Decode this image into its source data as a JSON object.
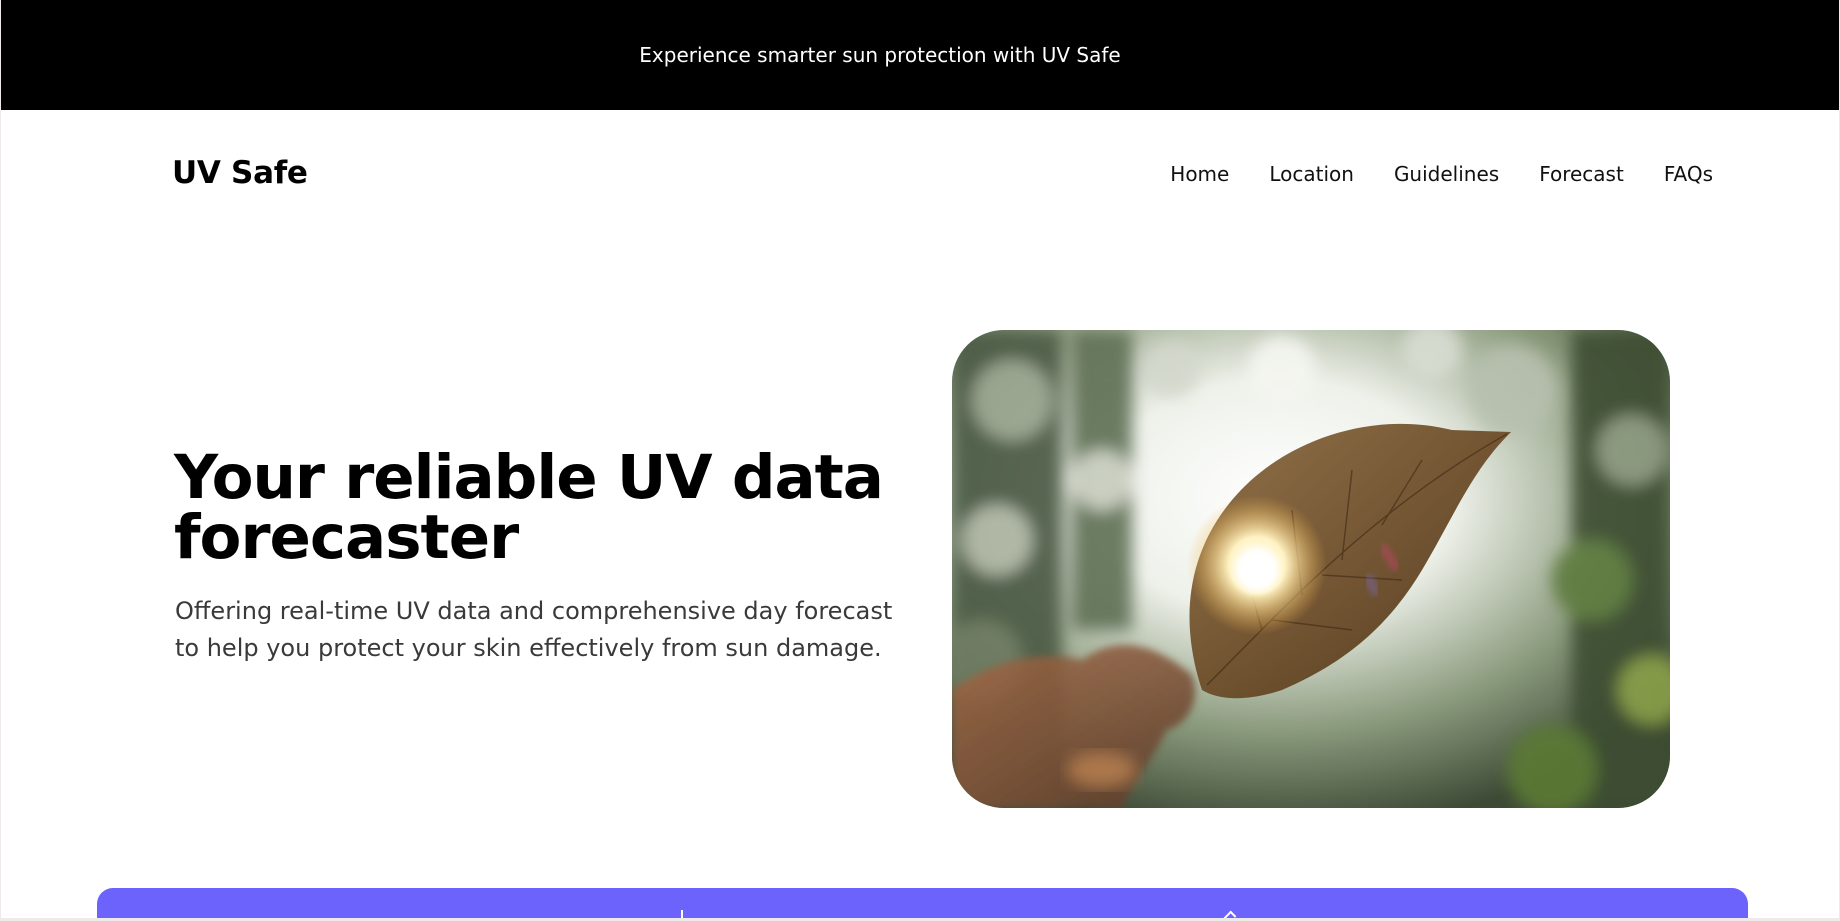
{
  "announcement": {
    "text": "Experience smarter sun protection with UV Safe"
  },
  "header": {
    "logo": "UV Safe",
    "nav": [
      {
        "label": "Home"
      },
      {
        "label": "Location"
      },
      {
        "label": "Guidelines"
      },
      {
        "label": "Forecast"
      },
      {
        "label": "FAQs"
      }
    ]
  },
  "hero": {
    "title": "Your reliable UV data forecaster",
    "subtitle": "Offering real-time UV data and comprehensive day forecast to help you protect your skin effectively from sun damage.",
    "image": "leaf-held-against-sunlight-photo"
  },
  "colors": {
    "announcement_bg": "#000000",
    "accent_bar": "#6b63fb",
    "text_primary": "#000000",
    "text_secondary": "#3a3a3a"
  }
}
